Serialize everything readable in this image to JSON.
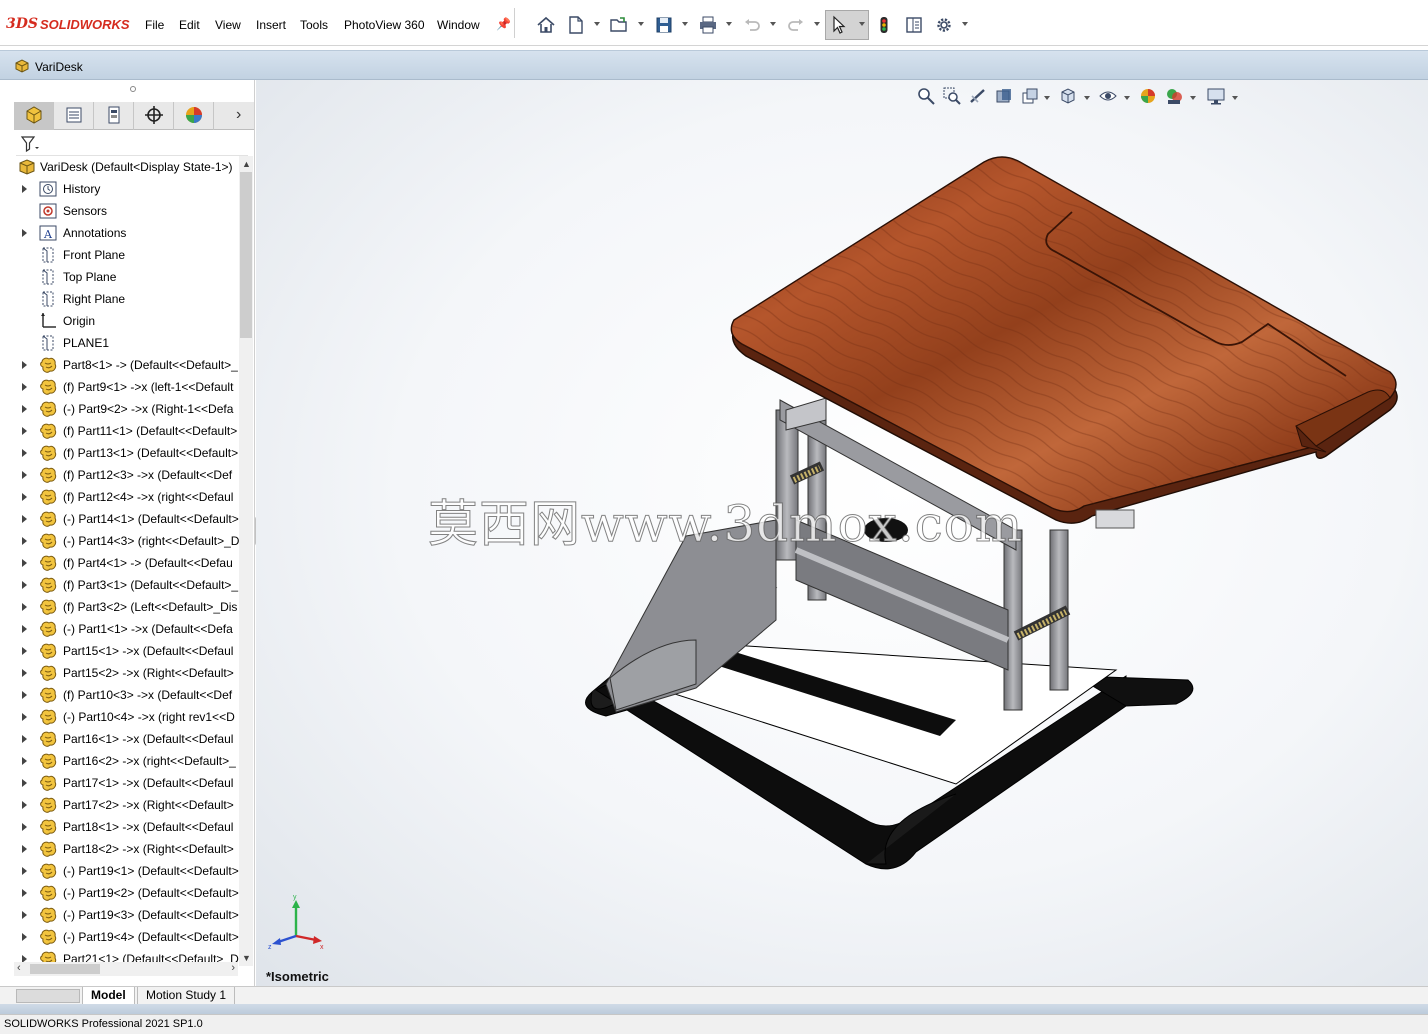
{
  "app": {
    "brand_prefix": "3DS",
    "brand_name": "SOLIDWORKS"
  },
  "menu": [
    "File",
    "Edit",
    "View",
    "Insert",
    "Tools",
    "PhotoView 360",
    "Window"
  ],
  "document": {
    "title": "VariDesk"
  },
  "feature_tree": {
    "root": "VariDesk  (Default<Display State-1>)",
    "items": [
      {
        "label": "History",
        "expandable": true,
        "icon": "history-icon"
      },
      {
        "label": "Sensors",
        "expandable": false,
        "icon": "sensors-icon"
      },
      {
        "label": "Annotations",
        "expandable": true,
        "icon": "annotations-icon"
      },
      {
        "label": "Front Plane",
        "expandable": false,
        "icon": "plane-icon"
      },
      {
        "label": "Top Plane",
        "expandable": false,
        "icon": "plane-icon"
      },
      {
        "label": "Right Plane",
        "expandable": false,
        "icon": "plane-icon"
      },
      {
        "label": "Origin",
        "expandable": false,
        "icon": "origin-icon"
      },
      {
        "label": "PLANE1",
        "expandable": false,
        "icon": "plane-icon"
      },
      {
        "label": "Part8<1> -> (Default<<Default>_",
        "expandable": true,
        "icon": "part-icon"
      },
      {
        "label": "(f) Part9<1> ->x (left-1<<Default",
        "expandable": true,
        "icon": "part-icon"
      },
      {
        "label": "(-) Part9<2> ->x (Right-1<<Defa",
        "expandable": true,
        "icon": "part-icon"
      },
      {
        "label": "(f) Part11<1> (Default<<Default>",
        "expandable": true,
        "icon": "part-icon"
      },
      {
        "label": "(f) Part13<1> (Default<<Default>",
        "expandable": true,
        "icon": "part-icon"
      },
      {
        "label": "(f) Part12<3> ->x (Default<<Def",
        "expandable": true,
        "icon": "part-icon"
      },
      {
        "label": "(f) Part12<4> ->x (right<<Defaul",
        "expandable": true,
        "icon": "part-icon"
      },
      {
        "label": "(-) Part14<1> (Default<<Default>",
        "expandable": true,
        "icon": "part-icon"
      },
      {
        "label": "(-) Part14<3> (right<<Default>_D",
        "expandable": true,
        "icon": "part-icon"
      },
      {
        "label": "(f) Part4<1> -> (Default<<Defau",
        "expandable": true,
        "icon": "part-icon"
      },
      {
        "label": "(f) Part3<1> (Default<<Default>_",
        "expandable": true,
        "icon": "part-icon"
      },
      {
        "label": "(f) Part3<2> (Left<<Default>_Dis",
        "expandable": true,
        "icon": "part-icon"
      },
      {
        "label": "(-) Part1<1> ->x (Default<<Defa",
        "expandable": true,
        "icon": "part-icon"
      },
      {
        "label": "Part15<1> ->x (Default<<Defaul",
        "expandable": true,
        "icon": "part-icon"
      },
      {
        "label": "Part15<2> ->x (Right<<Default>",
        "expandable": true,
        "icon": "part-icon"
      },
      {
        "label": "(f) Part10<3> ->x (Default<<Def",
        "expandable": true,
        "icon": "part-icon"
      },
      {
        "label": "(-) Part10<4> ->x (right rev1<<D",
        "expandable": true,
        "icon": "part-icon"
      },
      {
        "label": "Part16<1> ->x (Default<<Defaul",
        "expandable": true,
        "icon": "part-icon"
      },
      {
        "label": "Part16<2> ->x (right<<Default>_",
        "expandable": true,
        "icon": "part-icon"
      },
      {
        "label": "Part17<1> ->x (Default<<Defaul",
        "expandable": true,
        "icon": "part-icon"
      },
      {
        "label": "Part17<2> ->x (Right<<Default>",
        "expandable": true,
        "icon": "part-icon"
      },
      {
        "label": "Part18<1> ->x (Default<<Defaul",
        "expandable": true,
        "icon": "part-icon"
      },
      {
        "label": "Part18<2> ->x (Right<<Default>",
        "expandable": true,
        "icon": "part-icon"
      },
      {
        "label": "(-) Part19<1> (Default<<Default>",
        "expandable": true,
        "icon": "part-icon"
      },
      {
        "label": "(-) Part19<2> (Default<<Default>",
        "expandable": true,
        "icon": "part-icon"
      },
      {
        "label": "(-) Part19<3> (Default<<Default>",
        "expandable": true,
        "icon": "part-icon"
      },
      {
        "label": "(-) Part19<4> (Default<<Default>",
        "expandable": true,
        "icon": "part-icon"
      },
      {
        "label": "Part21<1> (Default<<Default>_D",
        "expandable": true,
        "icon": "part-icon"
      }
    ]
  },
  "graphics": {
    "watermark": "莫西网www.3dmox.com",
    "view_name": "*Isometric",
    "triad": {
      "x": "x",
      "y": "y",
      "z": "z"
    }
  },
  "bottom_tabs": [
    {
      "label": "Model",
      "active": true
    },
    {
      "label": "Motion Study 1",
      "active": false
    }
  ],
  "status": {
    "text": "SOLIDWORKS Professional 2021 SP1.0"
  },
  "colors": {
    "brand": "#d52b1e",
    "wood": "#a04420",
    "frame": "#8e8e92",
    "base": "#111111",
    "viewport_bg": "#f4f6f9"
  }
}
